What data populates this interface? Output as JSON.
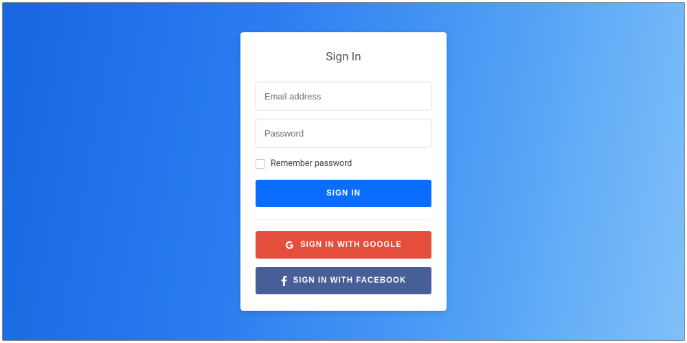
{
  "card": {
    "title": "Sign In",
    "email_placeholder": "Email address",
    "password_placeholder": "Password",
    "remember_label": "Remember password",
    "signin_label": "Sign In",
    "google_label": "Sign in with Google",
    "facebook_label": "Sign in with Facebook"
  },
  "colors": {
    "primary": "#0b6dff",
    "google": "#e54e3c",
    "facebook": "#475e96"
  }
}
